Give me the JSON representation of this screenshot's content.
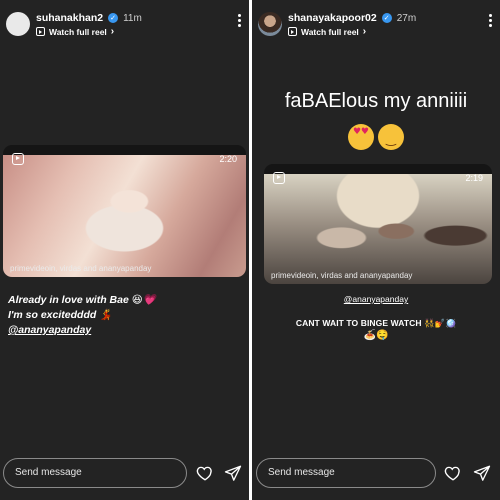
{
  "stories": {
    "left": {
      "username": "suhanakhan2",
      "time": "11m",
      "watch_label": "Watch full reel",
      "reel": {
        "duration": "2:20",
        "credit": "primevideoin, virdas and ananyapanday"
      },
      "caption": {
        "line1": "Already in love with Bae 😆💗",
        "line2": "I'm so excitedddd 💃",
        "mention": "@ananyapanday"
      },
      "message_placeholder": "Send message"
    },
    "right": {
      "username": "shanayakapoor02",
      "time": "27m",
      "watch_label": "Watch full reel",
      "headline": "faBAElous my anniiii",
      "emoji_line": "😍😉",
      "reel": {
        "duration": "2:19",
        "credit": "primevideoin, virdas and ananyapanday"
      },
      "mention": "@ananyapanday",
      "text_line": "CANT WAIT TO BINGE WATCH 👯💅🪩",
      "emoji_small": "🍝🤤",
      "message_placeholder": "Send message"
    }
  },
  "icons": {
    "verified": "verified-badge-icon",
    "reel": "reel-icon",
    "more": "more-options-icon",
    "heart": "heart-icon",
    "send": "send-icon"
  },
  "colors": {
    "background": "#232323",
    "verified": "#3897f0"
  }
}
